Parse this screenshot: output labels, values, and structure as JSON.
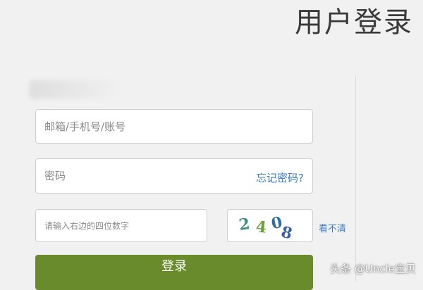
{
  "page_title": "用户登录",
  "form": {
    "account_placeholder": "邮箱/手机号/账号",
    "password_placeholder": "密码",
    "forgot_link": "忘记密码?",
    "captcha_placeholder": "请输入右边的四位数字",
    "captcha_chars": [
      "2",
      "4",
      "0",
      "8"
    ],
    "refresh_link": "看不清",
    "login_button": "登录"
  },
  "watermark": "头条 @Uncle宝贝",
  "colors": {
    "accent_button": "#6a8b2c",
    "link": "#3a7cc0",
    "background": "#f1f1f1"
  }
}
